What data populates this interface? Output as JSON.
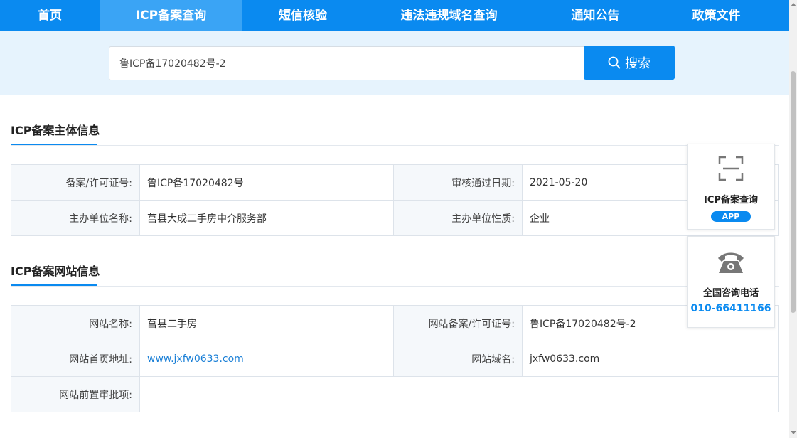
{
  "nav": {
    "items": [
      {
        "label": "首页"
      },
      {
        "label": "ICP备案查询"
      },
      {
        "label": "短信核验"
      },
      {
        "label": "违法违规域名查询"
      },
      {
        "label": "通知公告"
      },
      {
        "label": "政策文件"
      }
    ]
  },
  "search": {
    "value": "鲁ICP备17020482号-2",
    "button_label": "搜索"
  },
  "subject": {
    "title": "ICP备案主体信息",
    "license_label": "备案/许可证号:",
    "license_value": "鲁ICP备17020482号",
    "approve_date_label": "审核通过日期:",
    "approve_date_value": "2021-05-20",
    "org_name_label": "主办单位名称:",
    "org_name_value": "莒县大成二手房中介服务部",
    "org_type_label": "主办单位性质:",
    "org_type_value": "企业"
  },
  "website": {
    "title": "ICP备案网站信息",
    "site_name_label": "网站名称:",
    "site_name_value": "莒县二手房",
    "site_license_label": "网站备案/许可证号:",
    "site_license_value": "鲁ICP备17020482号-2",
    "homepage_label": "网站首页地址:",
    "homepage_value": "www.jxfw0633.com",
    "domain_label": "网站域名:",
    "domain_value": "jxfw0633.com",
    "preapproval_label": "网站前置审批项:",
    "preapproval_value": ""
  },
  "side": {
    "app_title": "ICP备案查询",
    "app_badge": "APP",
    "phone_title": "全国咨询电话",
    "phone_number": "010-66411166"
  },
  "colors": {
    "primary": "#0a8af0",
    "nav_active": "#3aa4f5",
    "search_band": "#e6f3fd"
  }
}
